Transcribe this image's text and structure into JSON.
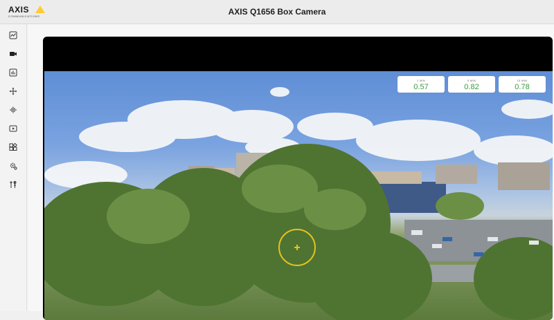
{
  "app": {
    "brand": "AXIS",
    "brand_sub": "COMMUNICATIONS",
    "title": "AXIS Q1656 Box Camera"
  },
  "sidebar": {
    "items": [
      {
        "icon": "status-icon"
      },
      {
        "icon": "video-icon"
      },
      {
        "icon": "analytics-icon"
      },
      {
        "icon": "ptz-icon"
      },
      {
        "icon": "audio-icon"
      },
      {
        "icon": "recordings-icon"
      },
      {
        "icon": "apps-icon"
      },
      {
        "icon": "system-icon"
      },
      {
        "icon": "maintenance-icon"
      }
    ]
  },
  "stats": [
    {
      "label": "1 MIN",
      "value": "0.57"
    },
    {
      "label": "5 MIN",
      "value": "0.82"
    },
    {
      "label": "15 MIN",
      "value": "0.78"
    }
  ],
  "colors": {
    "accent": "#ffcc33",
    "stat_value": "#3a9a3a",
    "ptz_ring": "#e8c21d"
  }
}
